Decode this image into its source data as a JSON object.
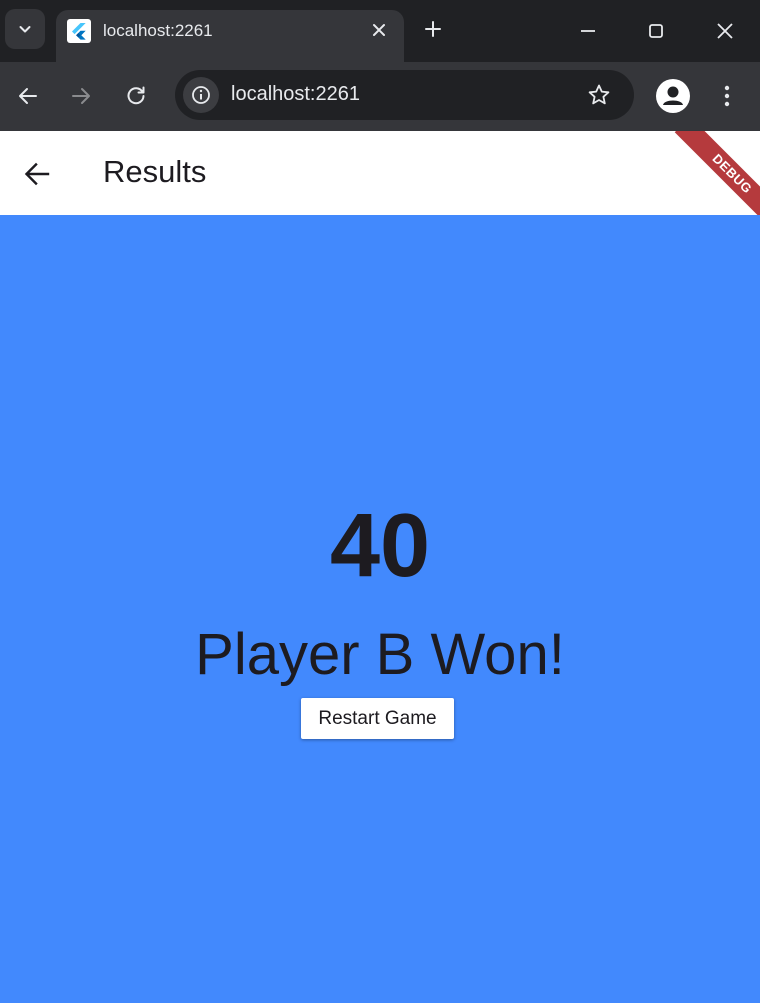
{
  "browser": {
    "tab_title": "localhost:2261",
    "url": "localhost:2261",
    "icons": {
      "tab_search": "chevron-down-icon",
      "favicon": "flutter-icon",
      "tab_close": "close-icon",
      "new_tab": "plus-icon",
      "minimize": "minimize-icon",
      "maximize": "maximize-icon",
      "window_close": "close-icon",
      "back": "arrow-left-icon",
      "forward": "arrow-right-icon",
      "reload": "reload-icon",
      "site_info": "info-icon",
      "bookmark": "star-icon",
      "profile": "person-icon",
      "menu": "more-vertical-icon"
    }
  },
  "app": {
    "title": "Results",
    "debug_banner": "DEBUG",
    "score": "40",
    "result_message": "Player B Won!",
    "restart_label": "Restart Game",
    "colors": {
      "background": "#4289fd",
      "appbar": "#ffffff",
      "text": "#1d1b20",
      "debug_banner": "#b53a3d"
    }
  }
}
